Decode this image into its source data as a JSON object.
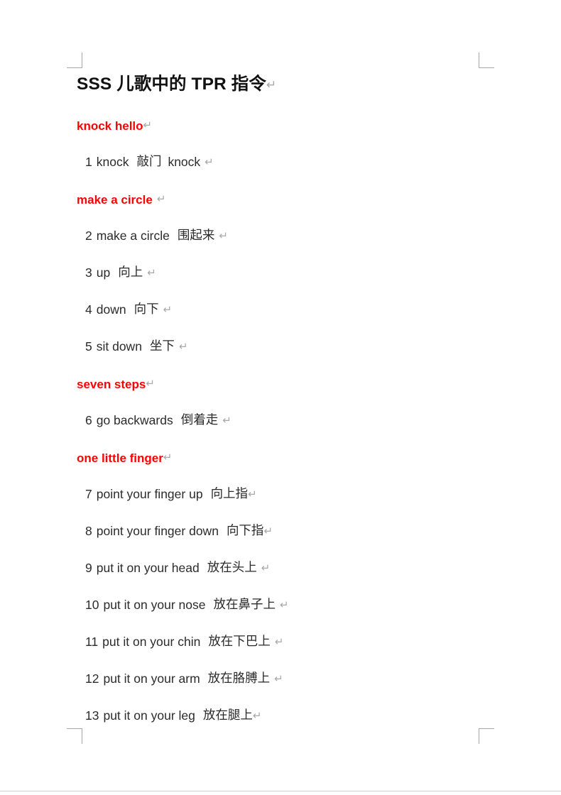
{
  "document": {
    "title": "SSS 儿歌中的 TPR 指令",
    "paragraph_mark": "↵",
    "heading_color": "#ff0000",
    "body_color": "#2b2b2b",
    "mark_color": "#a8a8a8"
  },
  "sections": [
    {
      "heading": "knock hello",
      "heading_trailing_space": false,
      "items": [
        {
          "number": "1",
          "english": "knock",
          "chinese": "敲门",
          "extra": "knock"
        }
      ]
    },
    {
      "heading": "make a circle",
      "heading_trailing_space": true,
      "items": [
        {
          "number": "2",
          "english": "make a circle",
          "chinese": "围起来",
          "extra": ""
        },
        {
          "number": "3",
          "english": "up",
          "chinese": "向上",
          "extra": ""
        },
        {
          "number": "4",
          "english": "down",
          "chinese": "向下",
          "extra": ""
        },
        {
          "number": "5",
          "english": "sit down",
          "chinese": "坐下",
          "extra": ""
        }
      ]
    },
    {
      "heading": "seven steps",
      "heading_trailing_space": false,
      "items": [
        {
          "number": "6",
          "english": "go backwards",
          "chinese": "倒着走",
          "extra": ""
        }
      ]
    },
    {
      "heading": "one little finger",
      "heading_trailing_space": false,
      "items": [
        {
          "number": "7",
          "english": "point your finger up",
          "chinese": "向上指",
          "extra": ""
        },
        {
          "number": "8",
          "english": "point your finger down",
          "chinese": "向下指",
          "extra": ""
        },
        {
          "number": "9",
          "english": "put it on your head",
          "chinese": "放在头上",
          "extra": ""
        },
        {
          "number": "10",
          "english": "put it on your nose",
          "chinese": "放在鼻子上",
          "extra": ""
        },
        {
          "number": "11",
          "english": "put it on your chin",
          "chinese": "放在下巴上",
          "extra": ""
        },
        {
          "number": "12",
          "english": "put it on your arm",
          "chinese": "放在胳膊上",
          "extra": ""
        },
        {
          "number": "13",
          "english": "put it on your leg",
          "chinese": "放在腿上",
          "extra": ""
        }
      ]
    }
  ]
}
